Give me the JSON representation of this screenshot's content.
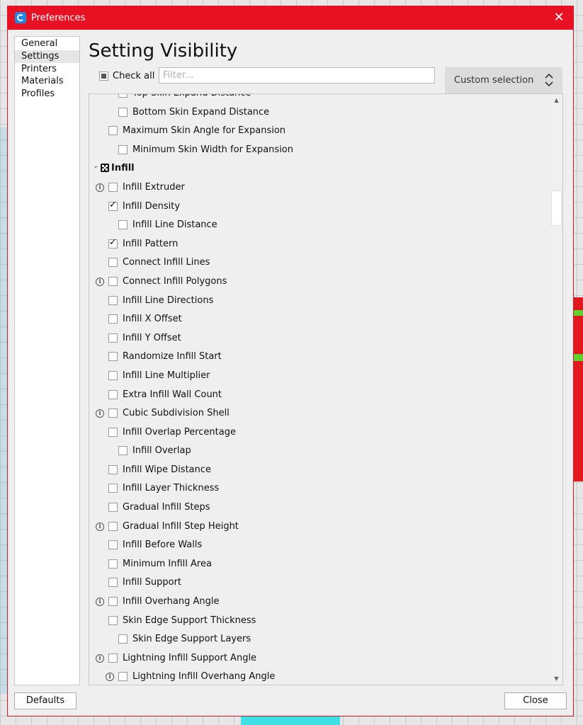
{
  "window": {
    "title": "Preferences",
    "close_glyph": "✕"
  },
  "nav": {
    "items": [
      "General",
      "Settings",
      "Printers",
      "Materials",
      "Profiles"
    ],
    "active": "Settings"
  },
  "page": {
    "title": "Setting Visibility"
  },
  "check_all": {
    "label": "Check all",
    "state": "partial"
  },
  "filter": {
    "placeholder": "Filter...",
    "value": ""
  },
  "selection": {
    "label": "Custom selection"
  },
  "settings_rows": [
    {
      "label": "Top Skin Expand Distance",
      "indent": 2,
      "checked": false,
      "info": false
    },
    {
      "label": "Bottom Skin Expand Distance",
      "indent": 2,
      "checked": false,
      "info": false
    },
    {
      "label": "Maximum Skin Angle for Expansion",
      "indent": 1,
      "checked": false,
      "info": false
    },
    {
      "label": "Minimum Skin Width for Expansion",
      "indent": 2,
      "checked": false,
      "info": false
    },
    {
      "label": "Infill",
      "category": true,
      "icon": "infill-icon"
    },
    {
      "label": "Infill Extruder",
      "indent": 1,
      "checked": false,
      "info": true
    },
    {
      "label": "Infill Density",
      "indent": 1,
      "checked": true,
      "info": false
    },
    {
      "label": "Infill Line Distance",
      "indent": 2,
      "checked": false,
      "info": false
    },
    {
      "label": "Infill Pattern",
      "indent": 1,
      "checked": true,
      "info": false
    },
    {
      "label": "Connect Infill Lines",
      "indent": 1,
      "checked": false,
      "info": false
    },
    {
      "label": "Connect Infill Polygons",
      "indent": 1,
      "checked": false,
      "info": true
    },
    {
      "label": "Infill Line Directions",
      "indent": 1,
      "checked": false,
      "info": false
    },
    {
      "label": "Infill X Offset",
      "indent": 1,
      "checked": false,
      "info": false
    },
    {
      "label": "Infill Y Offset",
      "indent": 1,
      "checked": false,
      "info": false
    },
    {
      "label": "Randomize Infill Start",
      "indent": 1,
      "checked": false,
      "info": false
    },
    {
      "label": "Infill Line Multiplier",
      "indent": 1,
      "checked": false,
      "info": false
    },
    {
      "label": "Extra Infill Wall Count",
      "indent": 1,
      "checked": false,
      "info": false
    },
    {
      "label": "Cubic Subdivision Shell",
      "indent": 1,
      "checked": false,
      "info": true
    },
    {
      "label": "Infill Overlap Percentage",
      "indent": 1,
      "checked": false,
      "info": false
    },
    {
      "label": "Infill Overlap",
      "indent": 2,
      "checked": false,
      "info": false
    },
    {
      "label": "Infill Wipe Distance",
      "indent": 1,
      "checked": false,
      "info": false
    },
    {
      "label": "Infill Layer Thickness",
      "indent": 1,
      "checked": false,
      "info": false
    },
    {
      "label": "Gradual Infill Steps",
      "indent": 1,
      "checked": false,
      "info": false
    },
    {
      "label": "Gradual Infill Step Height",
      "indent": 1,
      "checked": false,
      "info": true
    },
    {
      "label": "Infill Before Walls",
      "indent": 1,
      "checked": false,
      "info": false
    },
    {
      "label": "Minimum Infill Area",
      "indent": 1,
      "checked": false,
      "info": false
    },
    {
      "label": "Infill Support",
      "indent": 1,
      "checked": false,
      "info": false
    },
    {
      "label": "Infill Overhang Angle",
      "indent": 1,
      "checked": false,
      "info": true
    },
    {
      "label": "Skin Edge Support Thickness",
      "indent": 1,
      "checked": false,
      "info": false
    },
    {
      "label": "Skin Edge Support Layers",
      "indent": 2,
      "checked": false,
      "info": false
    },
    {
      "label": "Lightning Infill Support Angle",
      "indent": 1,
      "checked": false,
      "info": true
    },
    {
      "label": "Lightning Infill Overhang Angle",
      "indent": 2,
      "checked": false,
      "info": true
    }
  ],
  "buttons": {
    "defaults": "Defaults",
    "close": "Close"
  },
  "colors": {
    "titlebar": "#e81123",
    "dialog_bg": "#efefef",
    "select_bg": "#dcdcdc"
  }
}
